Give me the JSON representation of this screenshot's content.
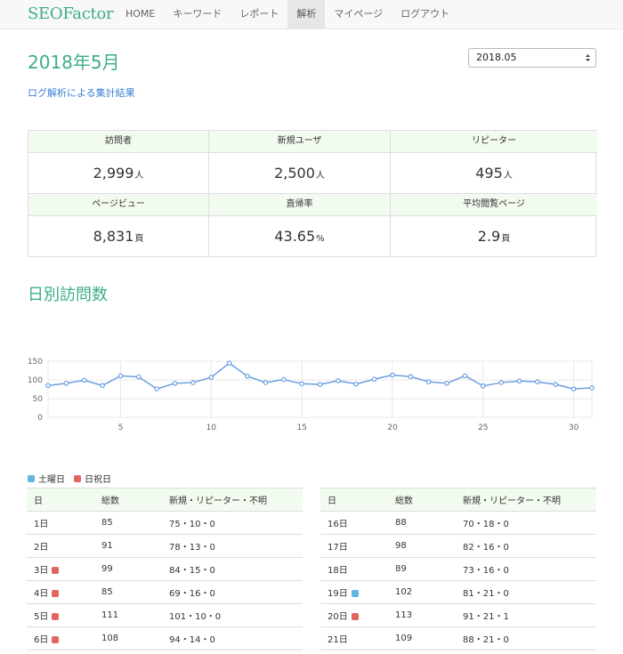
{
  "brand": "SEOFactor",
  "nav": [
    {
      "label": "HOME",
      "active": false
    },
    {
      "label": "キーワード",
      "active": false
    },
    {
      "label": "レポート",
      "active": false
    },
    {
      "label": "解析",
      "active": true
    },
    {
      "label": "マイページ",
      "active": false
    },
    {
      "label": "ログアウト",
      "active": false
    }
  ],
  "page": {
    "title": "2018年5月",
    "month_select": "2018.05",
    "subtitle": "ログ解析による集計結果"
  },
  "stats": {
    "visitors": {
      "label": "訪問者",
      "value": "2,999",
      "unit": "人"
    },
    "new_users": {
      "label": "新規ユーザ",
      "value": "2,500",
      "unit": "人"
    },
    "repeaters": {
      "label": "リピーター",
      "value": "495",
      "unit": "人"
    },
    "pageviews": {
      "label": "ページビュー",
      "value": "8,831",
      "unit": "頁"
    },
    "bounce_rate": {
      "label": "直帰率",
      "value": "43.65",
      "unit": "%"
    },
    "avg_pages": {
      "label": "平均閲覧ページ",
      "value": "2.9",
      "unit": "頁"
    }
  },
  "section_title": "日別訪問数",
  "chart_data": {
    "type": "line",
    "title": "",
    "xlabel": "",
    "ylabel": "",
    "x": [
      1,
      2,
      3,
      4,
      5,
      6,
      7,
      8,
      9,
      10,
      11,
      12,
      13,
      14,
      15,
      16,
      17,
      18,
      19,
      20,
      21,
      22,
      23,
      24,
      25,
      26,
      27,
      28,
      29,
      30,
      31
    ],
    "values": [
      85,
      91,
      99,
      85,
      111,
      108,
      76,
      91,
      93,
      107,
      145,
      110,
      93,
      101,
      90,
      88,
      98,
      89,
      102,
      113,
      109,
      95,
      91,
      111,
      84,
      93,
      97,
      95,
      88,
      76,
      79
    ],
    "xticks": [
      5,
      10,
      15,
      20,
      25,
      30
    ],
    "yticks": [
      0,
      50,
      100,
      150
    ],
    "xlim": [
      1,
      31
    ],
    "ylim": [
      0,
      150
    ],
    "grid": true,
    "line_color": "#6b9fe0"
  },
  "legend": {
    "saturday": "土曜日",
    "holiday": "日祝日"
  },
  "table_headers": {
    "day": "日",
    "total": "総数",
    "breakdown": "新規・リピーター・不明"
  },
  "table_left": [
    {
      "day": "1日",
      "total": "85",
      "breakdown": "75・10・0",
      "mark": ""
    },
    {
      "day": "2日",
      "total": "91",
      "breakdown": "78・13・0",
      "mark": ""
    },
    {
      "day": "3日",
      "total": "99",
      "breakdown": "84・15・0",
      "mark": "holiday"
    },
    {
      "day": "4日",
      "total": "85",
      "breakdown": "69・16・0",
      "mark": "holiday"
    },
    {
      "day": "5日",
      "total": "111",
      "breakdown": "101・10・0",
      "mark": "holiday"
    },
    {
      "day": "6日",
      "total": "108",
      "breakdown": "94・14・0",
      "mark": "holiday"
    }
  ],
  "table_right": [
    {
      "day": "16日",
      "total": "88",
      "breakdown": "70・18・0",
      "mark": ""
    },
    {
      "day": "17日",
      "total": "98",
      "breakdown": "82・16・0",
      "mark": ""
    },
    {
      "day": "18日",
      "total": "89",
      "breakdown": "73・16・0",
      "mark": ""
    },
    {
      "day": "19日",
      "total": "102",
      "breakdown": "81・21・0",
      "mark": "saturday"
    },
    {
      "day": "20日",
      "total": "113",
      "breakdown": "91・21・1",
      "mark": "holiday"
    },
    {
      "day": "21日",
      "total": "109",
      "breakdown": "88・21・0",
      "mark": ""
    }
  ]
}
